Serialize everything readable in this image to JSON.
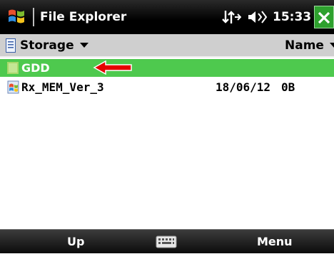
{
  "titlebar": {
    "title": "File Explorer",
    "time": "15:33",
    "icons": [
      "windows-start-icon",
      "connectivity-icon",
      "volume-icon",
      "close-icon"
    ]
  },
  "header": {
    "location": "Storage",
    "sort": "Name"
  },
  "files": [
    {
      "name": "GDD",
      "type": "folder",
      "date": "",
      "size": "",
      "selected": true
    },
    {
      "name": "Rx_MEM_Ver_3",
      "type": "file",
      "date": "18/06/12",
      "size": "0B",
      "selected": false
    }
  ],
  "annotation": {
    "icon": "red-arrow-icon",
    "color": "#e60000"
  },
  "softkeys": {
    "left": "Up",
    "right": "Menu",
    "center_icon": "keyboard-icon"
  },
  "colors": {
    "selection": "#4ec94e",
    "close": "#2ea12e"
  }
}
